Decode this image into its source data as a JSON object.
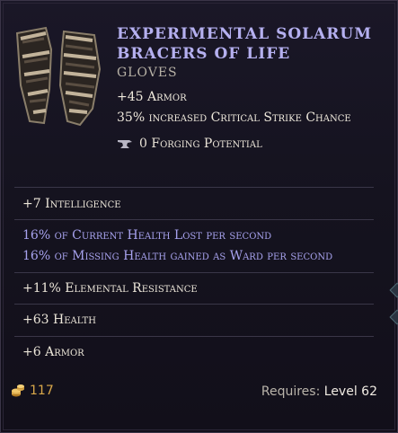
{
  "item": {
    "name": "EXPERIMENTAL SOLARUM BRACERS OF LIFE",
    "type": "GLOVES",
    "icon": "bracers-icon",
    "implicits": [
      "+45 Armor",
      "35% increased Critical Strike Chance"
    ],
    "forging": {
      "icon": "anvil-icon",
      "text": "0 Forging Potential"
    }
  },
  "affixes": [
    {
      "text": "+7 Intelligence",
      "color": "#ece6d9"
    },
    {
      "text": "16% of Current Health Lost per second",
      "color": "#a7a2ee"
    },
    {
      "text": "16% of Missing Health gained as Ward per second",
      "color": "#a7a2ee"
    },
    {
      "text": "+11% Elemental Resistance",
      "color": "#ece6d9"
    },
    {
      "text": "+63 Health",
      "color": "#ece6d9"
    },
    {
      "text": "+6 Armor",
      "color": "#ece6d9"
    }
  ],
  "footer": {
    "gold_icon": "gold-coins-icon",
    "gold_value": "117",
    "requires_label": "Requires:",
    "requires_level": "Level 62"
  },
  "colors": {
    "title": "#b5b0f0",
    "set_affix": "#a7a2ee",
    "gold": "#d9a84a",
    "background": "#15131f"
  }
}
